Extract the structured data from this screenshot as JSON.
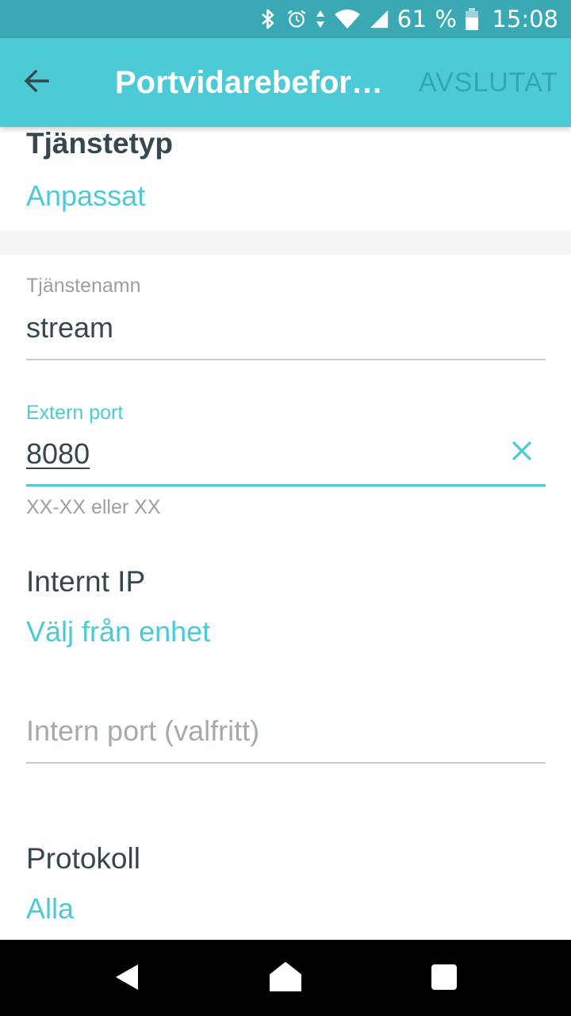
{
  "status_bar": {
    "battery_percent": "61 %",
    "time": "15:08",
    "icons": [
      "bluetooth-icon",
      "alarm-icon",
      "data-arrows-icon",
      "wifi-icon",
      "signal-icon",
      "battery-icon"
    ]
  },
  "app_bar": {
    "title": "Portvidarebefor…",
    "action_label": "AVSLUTAT",
    "back_icon": "arrow-left-icon"
  },
  "service_type": {
    "label": "Tjänstetyp",
    "value": "Anpassat"
  },
  "service_name": {
    "label": "Tjänstenamn",
    "value": "stream"
  },
  "external_port": {
    "label": "Extern port",
    "value": "8080",
    "helper": "XX-XX eller XX",
    "clear_icon": "close-icon"
  },
  "internal_ip": {
    "label": "Internt IP",
    "value": "Välj från enhet"
  },
  "internal_port": {
    "placeholder": "Intern port (valfritt)"
  },
  "protocol": {
    "label": "Protokoll",
    "value": "Alla"
  },
  "nav_bar": {
    "icons": [
      "back-triangle-icon",
      "home-icon",
      "recents-icon"
    ]
  },
  "colors": {
    "accent": "#4ccad5",
    "status_bar": "#3aa9b3",
    "text_dark": "#37474f",
    "text_hint": "#9aa0a3"
  }
}
